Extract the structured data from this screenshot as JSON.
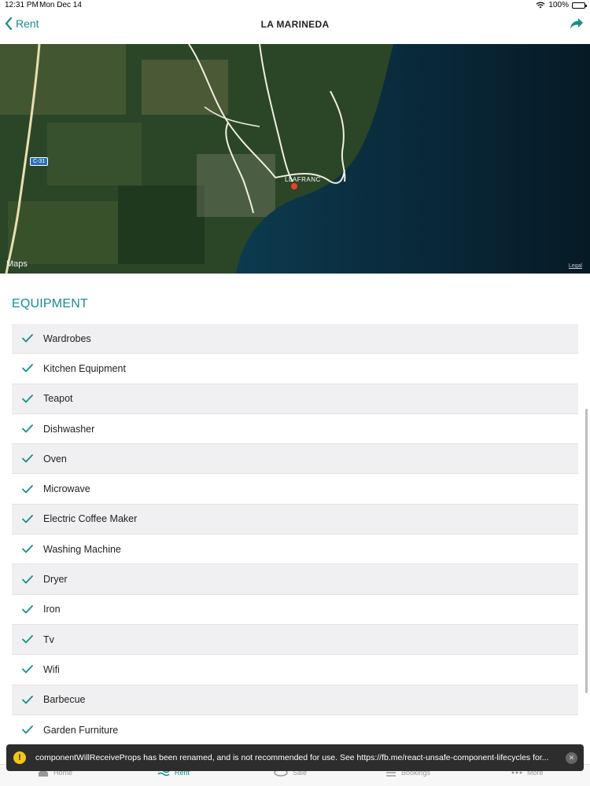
{
  "status_bar": {
    "time": "12:31 PM",
    "date": "Mon Dec 14",
    "battery": "100%"
  },
  "nav": {
    "back_label": "Rent",
    "title": "LA MARINEDA"
  },
  "map": {
    "attribution": "Maps",
    "legal": "Legal",
    "town": "LLAFRANC",
    "road_badge": "C-31"
  },
  "equipment": {
    "title": "EQUIPMENT",
    "items": [
      "Wardrobes",
      "Kitchen Equipment",
      "Teapot",
      "Dishwasher",
      "Oven",
      "Microwave",
      "Electric Coffee Maker",
      "Washing Machine",
      "Dryer",
      "Iron",
      "Tv",
      "Wifi",
      "Barbecue",
      "Garden Furniture"
    ]
  },
  "tabs": [
    {
      "label": "Home"
    },
    {
      "label": "Rent"
    },
    {
      "label": "Sale"
    },
    {
      "label": "Bookings"
    },
    {
      "label": "More"
    }
  ],
  "toast": {
    "message": "componentWillReceiveProps has been renamed, and is not recommended for use. See https://fb.me/react-unsafe-component-lifecycles for..."
  },
  "colors": {
    "accent": "#1a8c8c",
    "row_alt": "#f0f0f2",
    "toast_bg": "#2d2d2d",
    "warn": "#f5c518"
  }
}
